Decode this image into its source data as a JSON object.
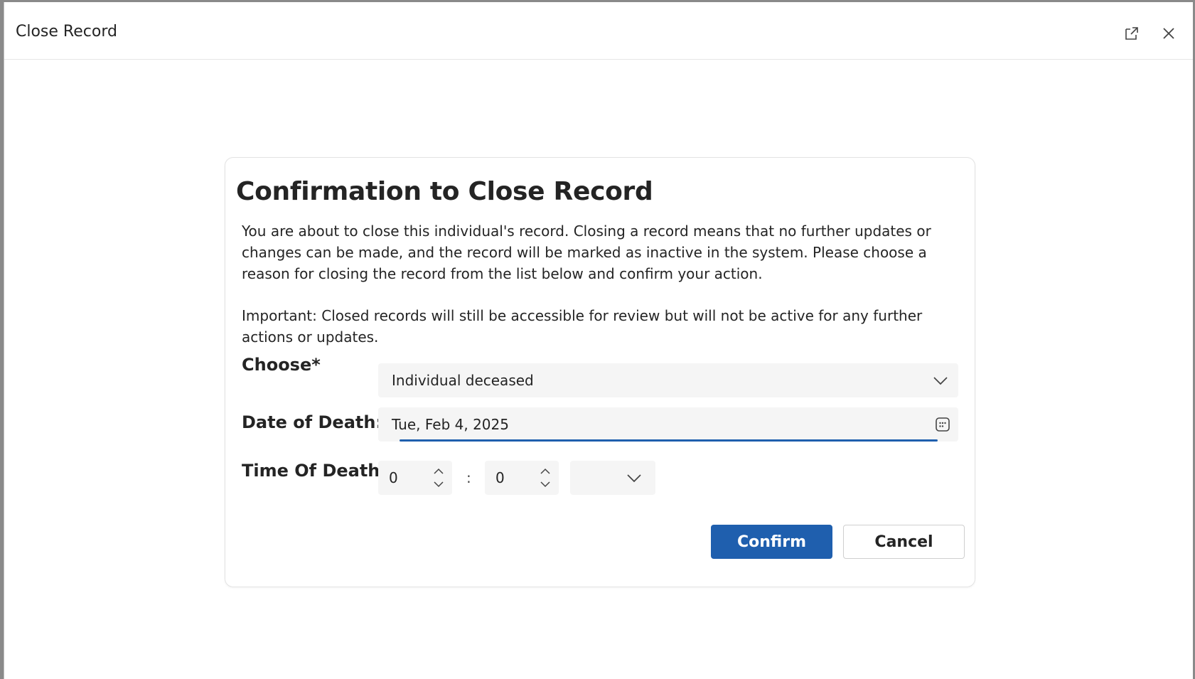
{
  "window": {
    "title": "Close Record",
    "popout_icon": "popout-icon",
    "close_icon": "close-icon"
  },
  "dialog": {
    "heading": "Confirmation to Close Record",
    "description_1": "You are about to close this individual's record. Closing a record means that no further updates or changes can be made, and the record will be marked as inactive in the system. Please choose a reason for closing the record from the list below and confirm your action.",
    "description_2": "Important: Closed records will still be accessible for review but will not be active for any further actions or updates.",
    "choose": {
      "label": "Choose*",
      "value": "Individual deceased",
      "icon": "chevron-down-icon"
    },
    "date_of_death": {
      "label": "Date of Death:",
      "value": "Tue, Feb 4, 2025",
      "icon": "calendar-icon"
    },
    "time_of_death": {
      "label": "Time Of Death:",
      "hour": "0",
      "separator": ":",
      "minute": "0",
      "ampm": ""
    },
    "confirm_label": "Confirm",
    "cancel_label": "Cancel"
  },
  "colors": {
    "accent": "#1f5fae",
    "field_bg": "#f5f5f5",
    "text": "#242424"
  }
}
